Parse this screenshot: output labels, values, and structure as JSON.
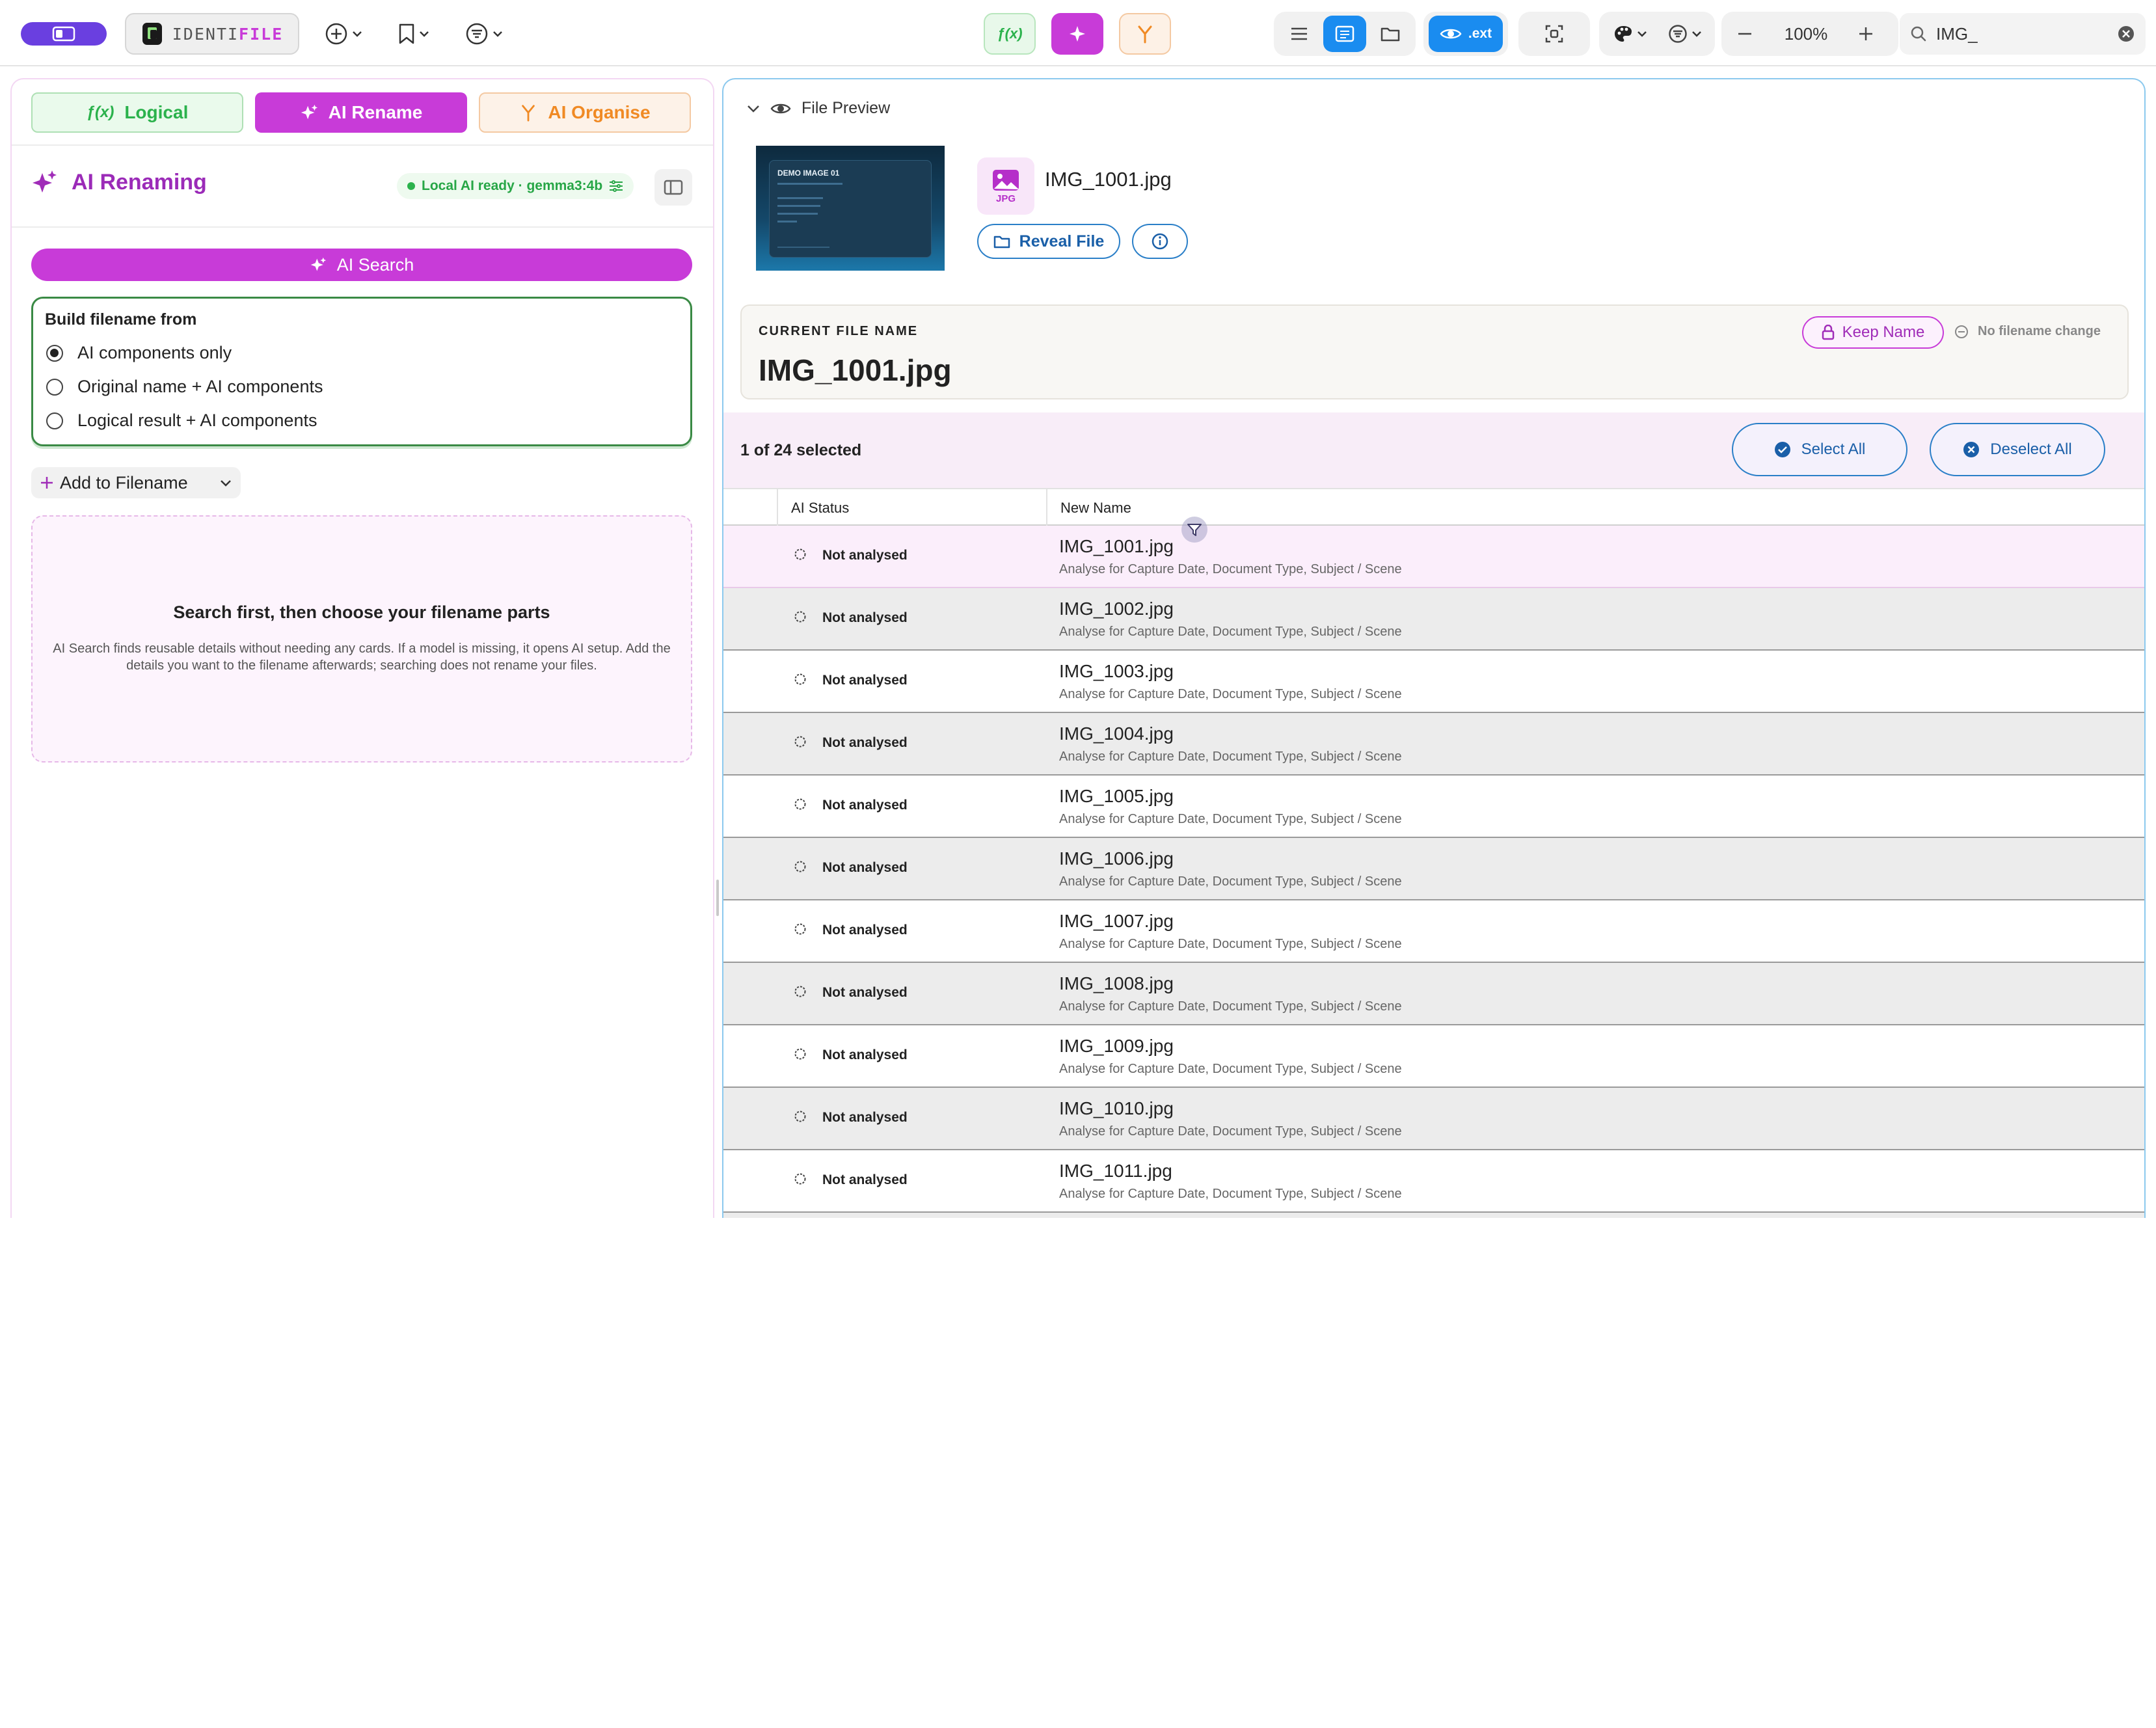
{
  "toolbar": {
    "brand_prefix": "IDENTI",
    "brand_suffix": "FILE",
    "ext_label": ".ext",
    "zoom_level": "100%",
    "search_value": "IMG_",
    "accent_color": "#c83bd8"
  },
  "left": {
    "tabs": [
      {
        "label": "Logical",
        "icon": "function-icon"
      },
      {
        "label": "AI Rename",
        "icon": "sparkle-icon"
      },
      {
        "label": "AI Organise",
        "icon": "branch-icon"
      }
    ],
    "title": "AI Renaming",
    "ai_status": "Local AI ready · gemma3:4b",
    "ai_search_label": "AI Search",
    "build_title": "Build filename from",
    "build_options": [
      {
        "label": "AI components only",
        "selected": true
      },
      {
        "label": "Original name + AI components",
        "selected": false
      },
      {
        "label": "Logical result + AI components",
        "selected": false
      }
    ],
    "add_to_filename_label": "Add to Filename",
    "empty_title": "Search first, then choose your filename parts",
    "empty_body": "AI Search finds reusable details without needing any cards. If a model is missing, it opens AI setup. Add the details you want to the filename afterwards; searching does not rename your files."
  },
  "preview": {
    "section_title": "File Preview",
    "thumb_title": "DEMO IMAGE 01",
    "file_name": "IMG_1001.jpg",
    "file_type": "JPG",
    "reveal_label": "Reveal File"
  },
  "current": {
    "label": "CURRENT FILE NAME",
    "file_name": "IMG_1001.jpg",
    "keep_label": "Keep Name",
    "change_status": "No filename change"
  },
  "selection": {
    "count_text": "1 of 24 selected",
    "select_all_label": "Select All",
    "deselect_all_label": "Deselect All"
  },
  "table": {
    "columns": [
      "AI Status",
      "New Name"
    ],
    "rows": [
      {
        "status": "Not analysed",
        "name": "IMG_1001.jpg",
        "hint": "Analyse for Capture Date, Document Type, Subject / Scene"
      },
      {
        "status": "Not analysed",
        "name": "IMG_1002.jpg",
        "hint": "Analyse for Capture Date, Document Type, Subject / Scene"
      },
      {
        "status": "Not analysed",
        "name": "IMG_1003.jpg",
        "hint": "Analyse for Capture Date, Document Type, Subject / Scene"
      },
      {
        "status": "Not analysed",
        "name": "IMG_1004.jpg",
        "hint": "Analyse for Capture Date, Document Type, Subject / Scene"
      },
      {
        "status": "Not analysed",
        "name": "IMG_1005.jpg",
        "hint": "Analyse for Capture Date, Document Type, Subject / Scene"
      },
      {
        "status": "Not analysed",
        "name": "IMG_1006.jpg",
        "hint": "Analyse for Capture Date, Document Type, Subject / Scene"
      },
      {
        "status": "Not analysed",
        "name": "IMG_1007.jpg",
        "hint": "Analyse for Capture Date, Document Type, Subject / Scene"
      },
      {
        "status": "Not analysed",
        "name": "IMG_1008.jpg",
        "hint": "Analyse for Capture Date, Document Type, Subject / Scene"
      },
      {
        "status": "Not analysed",
        "name": "IMG_1009.jpg",
        "hint": "Analyse for Capture Date, Document Type, Subject / Scene"
      },
      {
        "status": "Not analysed",
        "name": "IMG_1010.jpg",
        "hint": "Analyse for Capture Date, Document Type, Subject / Scene"
      },
      {
        "status": "Not analysed",
        "name": "IMG_1011.jpg",
        "hint": "Analyse for Capture Date, Document Type, Subject / Scene"
      }
    ]
  }
}
